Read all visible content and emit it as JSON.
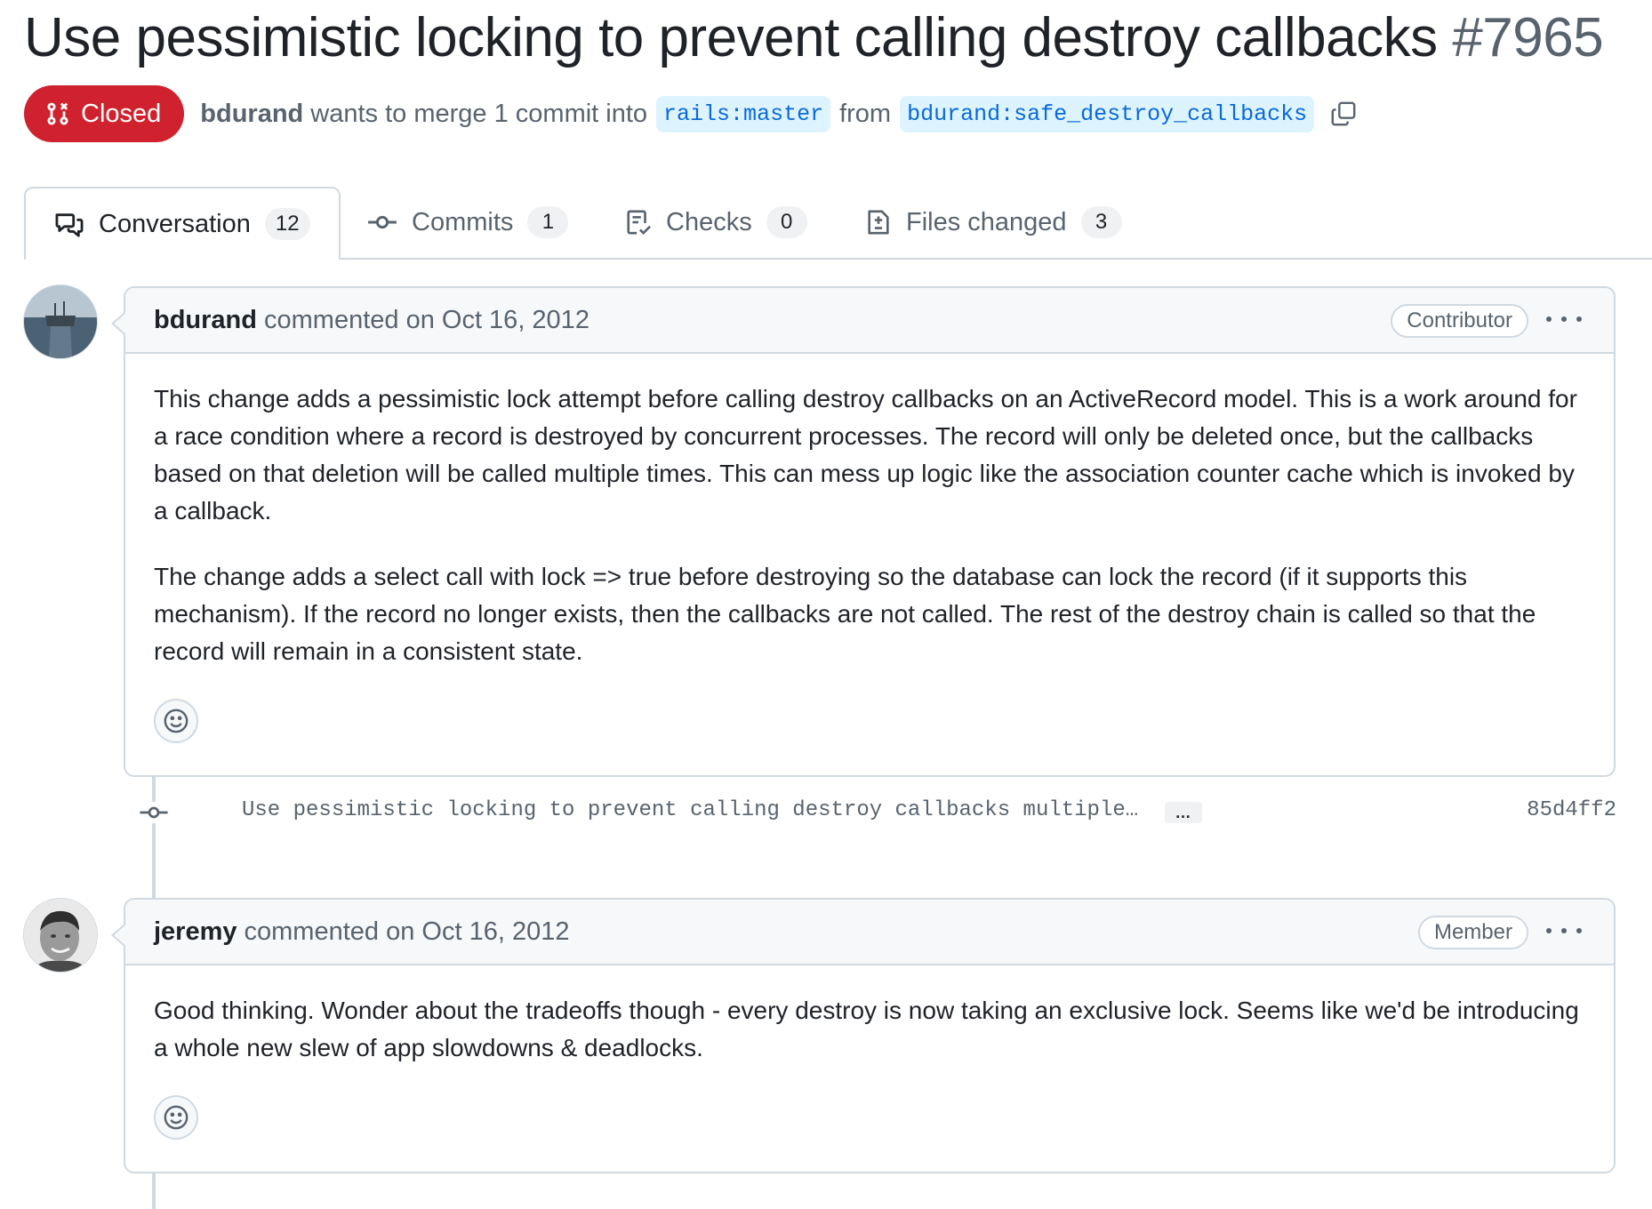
{
  "pr": {
    "title": "Use pessimistic locking to prevent calling destroy callbacks",
    "number": "#7965",
    "state": "Closed",
    "author": "bdurand",
    "merge_text": "wants to merge 1 commit into",
    "base_branch": "rails:master",
    "from_text": "from",
    "head_branch": "bdurand:safe_destroy_callbacks"
  },
  "tabs": [
    {
      "label": "Conversation",
      "count": "12",
      "icon": "comment-discussion-icon"
    },
    {
      "label": "Commits",
      "count": "1",
      "icon": "git-commit-icon"
    },
    {
      "label": "Checks",
      "count": "0",
      "icon": "checklist-icon"
    },
    {
      "label": "Files changed",
      "count": "3",
      "icon": "file-diff-icon"
    }
  ],
  "comments": [
    {
      "author": "bdurand",
      "action": "commented on Oct 16, 2012",
      "role": "Contributor",
      "paragraphs": [
        "This change adds a pessimistic lock attempt before calling destroy callbacks on an ActiveRecord model. This is a work around for a race condition where a record is destroyed by concurrent processes. The record will only be deleted once, but the callbacks based on that deletion will be called multiple times. This can mess up logic like the association counter cache which is invoked by a callback.",
        "The change adds a select call with lock => true before destroying so the database can lock the record (if it supports this mechanism). If the record no longer exists, then the callbacks are not called. The rest of the destroy chain is called so that the record will remain in a consistent state."
      ]
    },
    {
      "author": "jeremy",
      "action": "commented on Oct 16, 2012",
      "role": "Member",
      "paragraphs": [
        "Good thinking. Wonder about the tradeoffs though - every destroy is now taking an exclusive lock. Seems like we'd be introducing a whole new slew of app slowdowns & deadlocks."
      ]
    }
  ],
  "commit": {
    "message": "Use pessimistic locking to prevent calling destroy callbacks multiple…",
    "expand": "…",
    "sha": "85d4ff2"
  },
  "colors": {
    "closed": "#cf222e",
    "link": "#0969da",
    "branch_bg": "#ddf4ff",
    "border": "#d1d9e0",
    "muted": "#59636e"
  }
}
